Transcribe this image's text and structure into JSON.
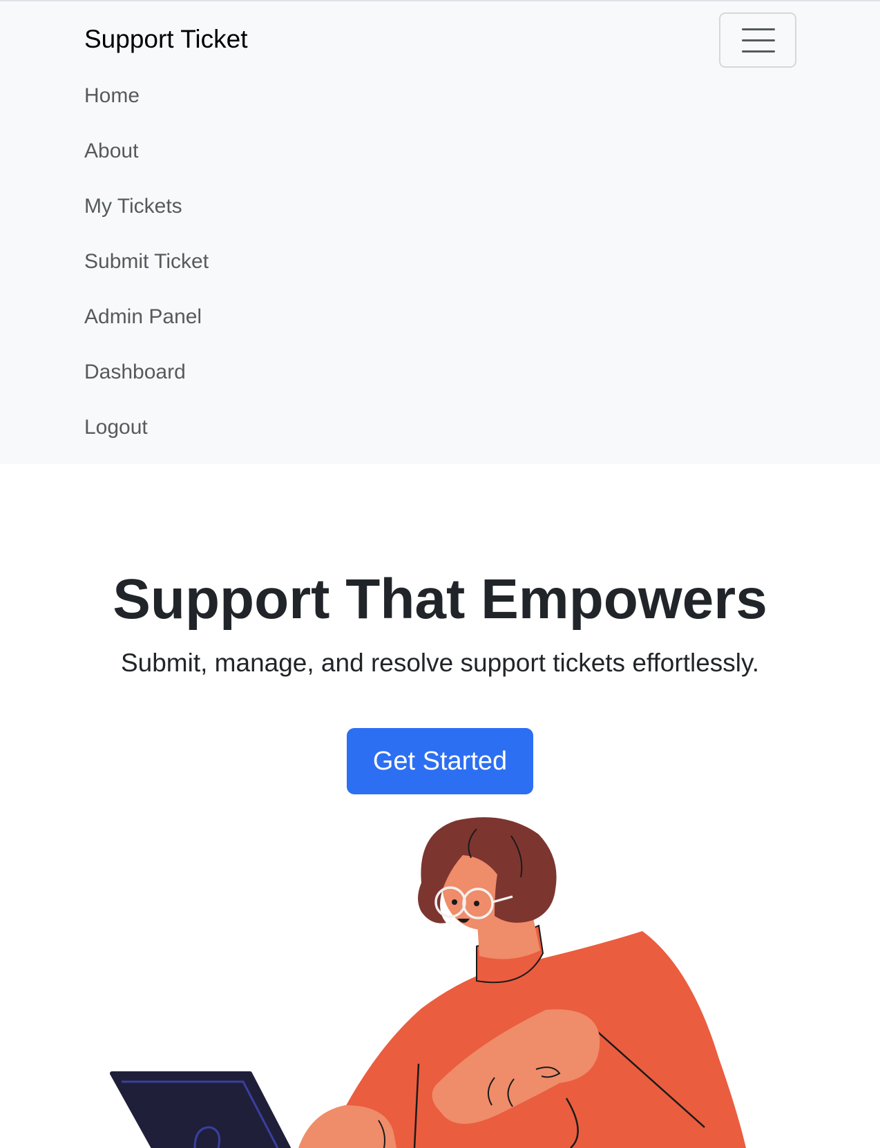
{
  "navbar": {
    "brand": "Support Ticket",
    "toggler_icon": "hamburger-menu-icon",
    "items": [
      {
        "label": "Home"
      },
      {
        "label": "About"
      },
      {
        "label": "My Tickets"
      },
      {
        "label": "Submit Ticket"
      },
      {
        "label": "Admin Panel"
      },
      {
        "label": "Dashboard"
      },
      {
        "label": "Logout"
      }
    ]
  },
  "hero": {
    "title": "Support That Empowers",
    "subtitle": "Submit, manage, and resolve support tickets effortlessly.",
    "cta_label": "Get Started"
  },
  "colors": {
    "navbar_bg": "#f8f9fa",
    "primary": "#2d6ff2",
    "text_dark": "#212529",
    "nav_link": "#555a5e",
    "sweater": "#ea5d3f",
    "skin": "#ef8c6a",
    "hair": "#7d3530",
    "laptop": "#1f1f3a"
  }
}
